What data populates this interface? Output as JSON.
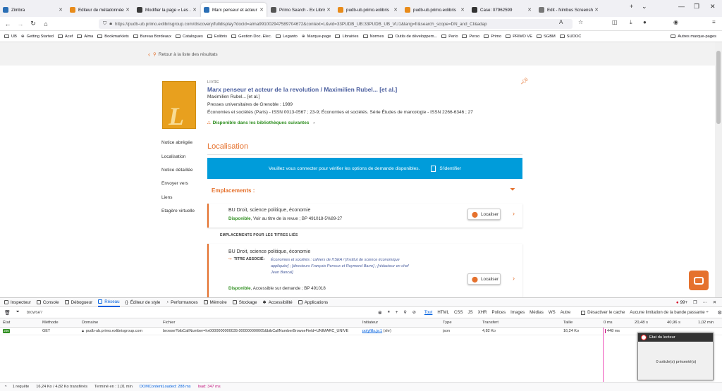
{
  "tabs": [
    {
      "label": "Zimbra",
      "color": "#2b6fb5"
    },
    {
      "label": "Éditeur de métadonnées",
      "color": "#e88b1a"
    },
    {
      "label": "Modifier la page « Les ...",
      "color": "#3b3b3b"
    },
    {
      "label": "Marx penseur et acteur",
      "color": "#2b6fb5",
      "active": true
    },
    {
      "label": "Primo Search - Ex Libris",
      "color": "#555555"
    },
    {
      "label": "pudb-ub.primo.exlibris",
      "color": "#e88b1a"
    },
    {
      "label": "pudb-ub.primo.exlibris",
      "color": "#e88b1a"
    },
    {
      "label": "Case: 07962599",
      "color": "#333333"
    },
    {
      "label": "Edit - Nimbus Screenshot",
      "color": "#777777"
    }
  ],
  "url": "https://pudb-ub.primo.exlibrisgroup.com/discovery/fulldisplay?docid=alma991002947589704672&context=L&vid=33PUDB_UB:33PUDB_UB_VU1&lang=fr&search_scope=DN_and_CI&adap",
  "bookmarks": [
    "UB",
    "Getting Started",
    "Acef",
    "Alma",
    "Bookmarklets",
    "Bureau Bordeaux",
    "Catalogues",
    "Exlibris",
    "Gestion Doc. Elec.",
    "Leganto",
    "Marque-page",
    "Librairies",
    "Normes",
    "Outils de développem...",
    "Perio",
    "Perso",
    "Primo",
    "PRIMO VE",
    "SGBM",
    "SUDOC",
    "Autres marque-pages"
  ],
  "record": {
    "back": "Retour à la liste des résultats",
    "type": "LIVRE",
    "thumb_letter": "L",
    "title": "Marx penseur et acteur de la revolution / Maximilien Rubel... [et al.]",
    "author": "Maximilien Rubel... [et al.]",
    "publisher": "Presses universitaires de Grenoble : 1989",
    "series": "Économies et sociétés (Paris) - ISSN 0013-0567 ; 23-9; Économies et sociétés. Série Études de marxologie - ISSN 2266-6346 ; 27",
    "availability": "Disponible dans les bibliothèques suivantes"
  },
  "side_nav": [
    "Notice abrégée",
    "Localisation",
    "Notice détaillée",
    "Envoyer vers",
    "Liens",
    "Etagère virtuelle"
  ],
  "localisation": {
    "title": "Localisation",
    "login_msg": "Veuillez vous connecter pour vérifier les options de demande disponibles.",
    "signin": "S'identifier",
    "emplacements": "Emplacements :",
    "related_header": "EMPLACEMENTS POUR LES TITRES LIÉS",
    "card1": {
      "library": "BU Droit, science politique, économie",
      "status": "Disponible",
      "detail": ", Voir au titre de la revue ; BP 491018-5%89-27",
      "button": "Localiser"
    },
    "card2": {
      "library": "BU Droit, science politique, économie",
      "assoc_label": "TITRE ASSOCIÉ:",
      "assoc_value": "Économies et sociétés : cahiers de l'ISEA / [Institut de science économique appliquée] ; [directeurs François Perroux et Raymond Barre] ; [rédacteur en chef Jean Bancal]",
      "status": "Disponible",
      "detail": ", Accessible sur demande ; BP 491018",
      "button": "Localiser"
    }
  },
  "devtools": {
    "tabs": [
      "Inspecteur",
      "Console",
      "Débogueur",
      "Réseau",
      "Éditeur de style",
      "Performances",
      "Mémoire",
      "Stockage",
      "Accessibilité",
      "Applications"
    ],
    "active_tab": "Réseau",
    "errors": "99+",
    "filter": "browse?",
    "filter_types": [
      "Tout",
      "HTML",
      "CSS",
      "JS",
      "XHR",
      "Polices",
      "Images",
      "Médias",
      "WS",
      "Autre"
    ],
    "disable_cache": "Désactiver le cache",
    "throttle": "Aucune limitation de la bande passante ÷",
    "columns": [
      "État",
      "Méthode",
      "Domaine",
      "Fichier",
      "Initiateur",
      "Type",
      "Transfert",
      "Taille",
      "0 ms",
      "20,48 s",
      "40,96 s",
      "1,02 min"
    ],
    "row": {
      "status": "200",
      "method": "GET",
      "domain": "pudb-ub.primo.exlibrisgroup.com",
      "file": "browse?bibCallNumber=hx0000000000039.000000000005&bibCallNumberBrowseField=UNIMARC_UNIVE",
      "initiator": "polyfills.js:1",
      "initiator_type": "(xhr)",
      "type": "json",
      "transfer": "4,82 Ko",
      "size": "16,24 Ko",
      "time": "448 ms"
    },
    "status_bar": [
      "1 requête",
      "16,24 Ko / 4,82 Ko transférés",
      "Terminé en : 1,01 min",
      "DOMContentLoaded: 288 ms",
      "load: 347 ms"
    ]
  },
  "popup": {
    "title": "Etat du lecteur",
    "body": "0 article(s) présenté(s)"
  }
}
